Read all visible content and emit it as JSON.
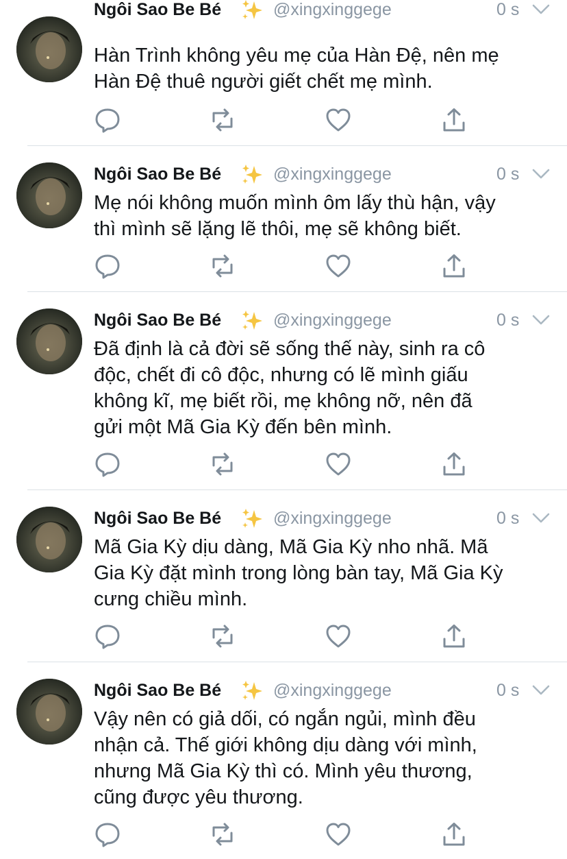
{
  "tweets": [
    {
      "name": "Ngôi Sao Be Bé",
      "handle": "@xingxinggege",
      "time": "0 s",
      "lines": [
        "Hàn Trình không yêu mẹ của Hàn Đệ, nên mẹ",
        "Hàn Đệ thuê người giết chết mẹ mình."
      ]
    },
    {
      "name": "Ngôi Sao Be Bé",
      "handle": "@xingxinggege",
      "time": "0 s",
      "lines": [
        "Mẹ nói không muốn mình ôm lấy thù hận, vậy",
        "thì mình sẽ lặng lẽ thôi, mẹ sẽ không biết."
      ]
    },
    {
      "name": "Ngôi Sao Be Bé",
      "handle": "@xingxinggege",
      "time": "0 s",
      "lines": [
        "Đã định là cả đời sẽ sống thế này, sinh ra cô",
        "độc, chết đi cô độc, nhưng có lẽ mình giấu",
        "không kĩ, mẹ biết rồi, mẹ không nỡ, nên đã",
        "gửi một Mã Gia Kỳ đến bên mình."
      ]
    },
    {
      "name": "Ngôi Sao Be Bé",
      "handle": "@xingxinggege",
      "time": "0 s",
      "lines": [
        "Mã Gia Kỳ dịu dàng, Mã Gia Kỳ nho nhã. Mã",
        "Gia Kỳ đặt mình trong lòng bàn tay, Mã Gia Kỳ",
        "cưng chiều mình."
      ]
    },
    {
      "name": "Ngôi Sao Be Bé",
      "handle": "@xingxinggege",
      "time": "0 s",
      "lines": [
        "Vậy nên có giả dối, có ngắn ngủi, mình đều",
        "nhận cả. Thế giới không dịu dàng với mình,",
        "nhưng Mã Gia Kỳ thì có. Mình yêu thương,",
        "cũng được yêu thương."
      ]
    }
  ],
  "icons": {
    "reply": "reply-icon",
    "retweet": "retweet-icon",
    "like": "like-icon",
    "share": "share-icon",
    "caret": "chevron-down-icon",
    "sparkles": "sparkles-emoji-icon"
  },
  "colors": {
    "text": "#14171a",
    "secondary": "#8a96a3",
    "divider": "#dbe1e6",
    "sparkle": "#f5c542"
  }
}
